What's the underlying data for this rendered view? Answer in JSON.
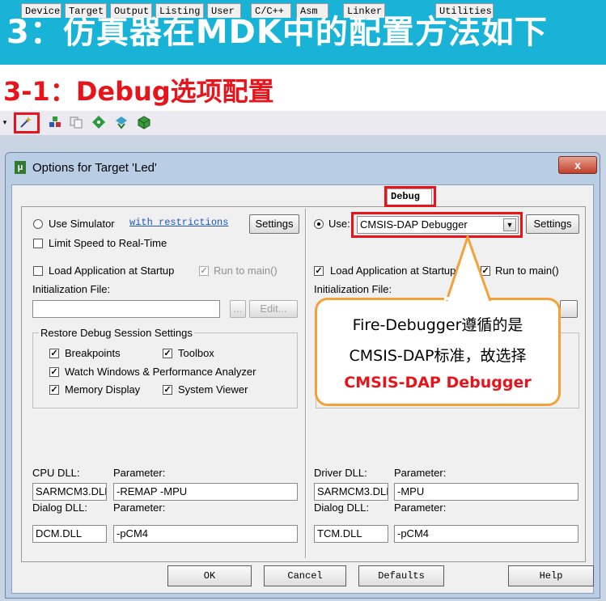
{
  "banner": {
    "title": "3：仿真器在MDK中的配置方法如下"
  },
  "subtitle": "3-1：Debug选项配置",
  "toolbar": {
    "icons": [
      "magic-wand-icon",
      "load-icon",
      "copy-icon",
      "diamond-icon",
      "download-icon",
      "pack-icon"
    ]
  },
  "dialog": {
    "title": "Options for Target 'Led'",
    "close": "x",
    "tabs": [
      "Device",
      "Target",
      "Output",
      "Listing",
      "User",
      "C/C++",
      "Asm",
      "Linker",
      "Debug",
      "Utilities"
    ],
    "active_tab": "Debug"
  },
  "left": {
    "use_simulator": "Use Simulator",
    "with_restrictions": "with restrictions",
    "settings": "Settings",
    "limit_speed": "Limit Speed to Real-Time",
    "load_app": "Load Application at Startup",
    "run_to_main": "Run to main()",
    "init_file": "Initialization File:",
    "browse": "...",
    "edit": "Edit...",
    "restore_group": "Restore Debug Session Settings",
    "breakpoints": "Breakpoints",
    "toolbox": "Toolbox",
    "watch": "Watch Windows & Performance Analyzer",
    "memory": "Memory Display",
    "system_viewer": "System Viewer",
    "cpu_dll_label": "CPU DLL:",
    "cpu_param_label": "Parameter:",
    "cpu_dll": "SARMCM3.DLL",
    "cpu_param": "-REMAP -MPU",
    "dialog_dll_label": "Dialog DLL:",
    "dialog_param_label": "Parameter:",
    "dialog_dll": "DCM.DLL",
    "dialog_param": "-pCM4"
  },
  "right": {
    "use": "Use:",
    "debugger": "CMSIS-DAP Debugger",
    "settings": "Settings",
    "load_app": "Load Application at Startup",
    "run_to_main": "Run to main()",
    "init_file": "Initialization File:",
    "driver_dll_label": "Driver DLL:",
    "driver_param_label": "Parameter:",
    "driver_dll": "SARMCM3.DLL",
    "driver_param": "-MPU",
    "dialog_dll_label": "Dialog DLL:",
    "dialog_param_label": "Parameter:",
    "dialog_dll": "TCM.DLL",
    "dialog_param": "-pCM4"
  },
  "callout": {
    "line1": "Fire-Debugger遵循的是",
    "line2": "CMSIS-DAP标准，故选择",
    "line3": "CMSIS-DAP Debugger"
  },
  "buttons": {
    "ok": "OK",
    "cancel": "Cancel",
    "defaults": "Defaults",
    "help": "Help"
  },
  "colors": {
    "banner": "#19b3d8",
    "accent_red": "#e8141b",
    "callout_border": "#f5a13a"
  }
}
